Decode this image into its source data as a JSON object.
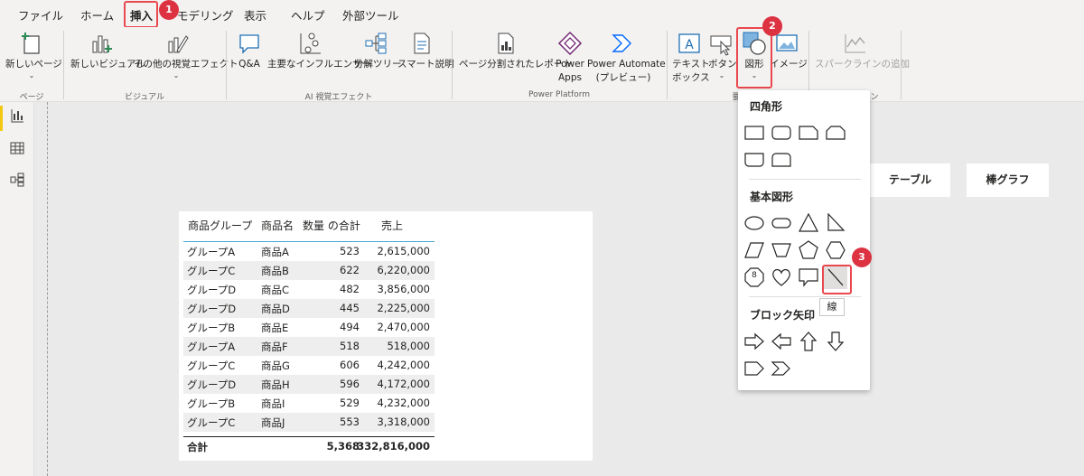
{
  "menu": {
    "tabs": [
      "ファイル",
      "ホーム",
      "挿入",
      "モデリング",
      "表示",
      "ヘルプ",
      "外部ツール"
    ],
    "active_tab": "挿入"
  },
  "steps": [
    "1",
    "2",
    "3"
  ],
  "ribbon": {
    "new_page": "新しいページ",
    "new_visual": "新しいビジュアル",
    "more_visuals": "その他の視覚エフェクト",
    "qa": "Q&A",
    "key_influencers": "主要なインフルエンサー",
    "decomp_tree": "分解ツリー",
    "smart_narrative": "スマート説明",
    "paginated_report": "ページ分割されたレポート",
    "power_apps_1": "Power",
    "power_apps_2": "Apps",
    "power_automate_1": "Power Automate",
    "power_automate_2": "(プレビュー)",
    "text_box_1": "テキスト",
    "text_box_2": "ボックス",
    "buttons": "ボタン",
    "shapes": "図形",
    "image": "イメージ",
    "sparkline": "スパークラインの追加",
    "groups": {
      "pages": "ページ",
      "visuals": "ビジュアル",
      "ai_visuals": "AI 視覚エフェクト",
      "power_platform": "Power Platform",
      "elements": "要",
      "sparklines": "ン"
    }
  },
  "table": {
    "headers": [
      "商品グループ",
      "商品名",
      "数量 の合計",
      "売上"
    ],
    "rows": [
      [
        "グループA",
        "商品A",
        "523",
        "2,615,000"
      ],
      [
        "グループC",
        "商品B",
        "622",
        "6,220,000"
      ],
      [
        "グループD",
        "商品C",
        "482",
        "3,856,000"
      ],
      [
        "グループD",
        "商品D",
        "445",
        "2,225,000"
      ],
      [
        "グループB",
        "商品E",
        "494",
        "2,470,000"
      ],
      [
        "グループA",
        "商品F",
        "518",
        "518,000"
      ],
      [
        "グループC",
        "商品G",
        "606",
        "4,242,000"
      ],
      [
        "グループD",
        "商品H",
        "596",
        "4,172,000"
      ],
      [
        "グループB",
        "商品I",
        "529",
        "4,232,000"
      ],
      [
        "グループC",
        "商品J",
        "553",
        "3,318,000"
      ]
    ],
    "total": [
      "合計",
      "",
      "5,368",
      "332,816,000"
    ]
  },
  "cards": {
    "table_card": "テーブル",
    "bar_card": "棒グラフ"
  },
  "dropdown": {
    "rectangles": "四角形",
    "basic_shapes": "基本図形",
    "block_arrows": "ブロック矢印",
    "line_tooltip": "線",
    "octagon_label": "8"
  },
  "colors": {
    "accent_yellow": "#f2c811",
    "annotation_red": "#dc3241",
    "table_rule": "#46a7d7",
    "icon_blue": "#1f6fb4"
  }
}
